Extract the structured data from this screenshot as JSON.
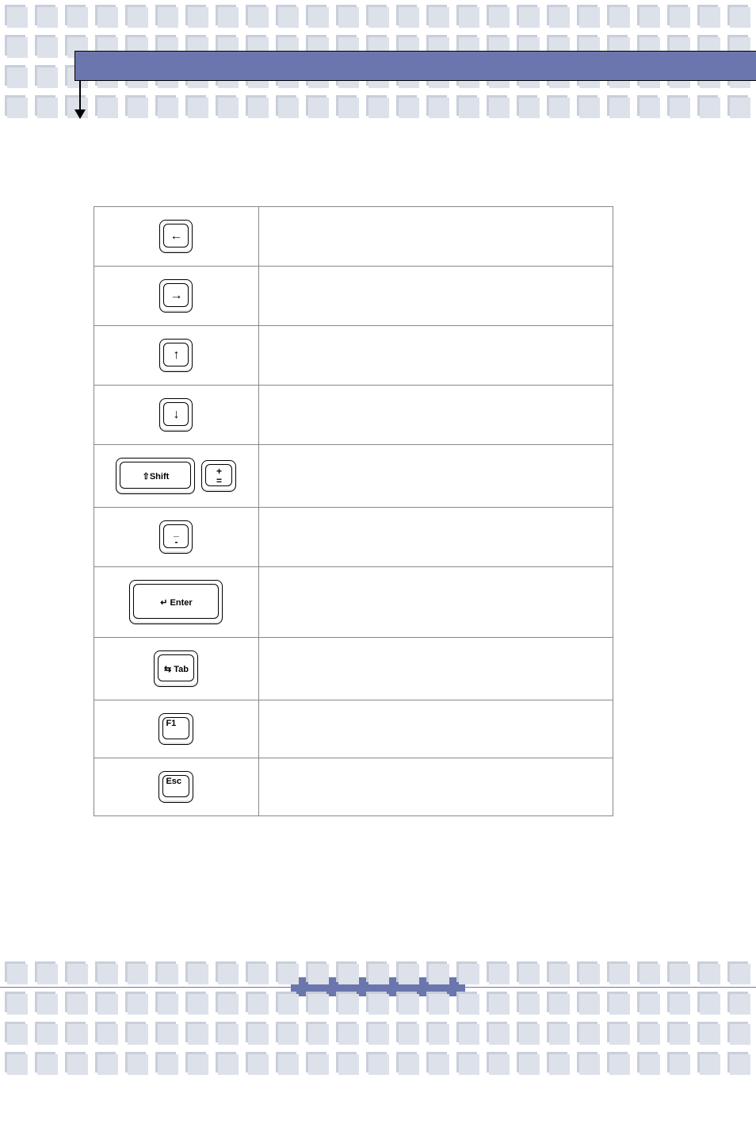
{
  "header": {
    "title": ""
  },
  "rows": [
    {
      "key_name": "left-arrow-key",
      "glyph": "←",
      "type": "arrow",
      "size": "k-small",
      "desc": ""
    },
    {
      "key_name": "right-arrow-key",
      "glyph": "→",
      "type": "arrow",
      "size": "k-small",
      "desc": ""
    },
    {
      "key_name": "up-arrow-key",
      "glyph": "↑",
      "type": "arrow",
      "size": "k-small",
      "desc": ""
    },
    {
      "key_name": "down-arrow-key",
      "glyph": "↓",
      "type": "arrow",
      "size": "k-small",
      "desc": ""
    },
    {
      "key_name": "shift-plus-combo",
      "type": "combo",
      "keys": [
        {
          "name": "shift-key",
          "size": "k-wide",
          "label": "⇧Shift"
        },
        {
          "name": "plus-equals-key",
          "size": "k-smlabel",
          "stack_top": "+",
          "stack_bottom": "="
        }
      ],
      "desc": ""
    },
    {
      "key_name": "minus-key",
      "type": "stack",
      "size": "k-small",
      "stack_top": "_",
      "stack_bottom": "-",
      "desc": ""
    },
    {
      "key_name": "enter-key",
      "type": "label",
      "size": "k-xwide",
      "label": "↵ Enter",
      "desc": ""
    },
    {
      "key_name": "tab-key",
      "type": "label",
      "size": "k-med",
      "label": "⇆ Tab",
      "desc": ""
    },
    {
      "key_name": "f1-key",
      "type": "corner",
      "size": "k-smlabel",
      "label": "F1",
      "desc": ""
    },
    {
      "key_name": "esc-key",
      "type": "corner",
      "size": "k-smlabel",
      "label": "Esc",
      "desc": ""
    }
  ],
  "footer": {
    "page_label": ""
  }
}
